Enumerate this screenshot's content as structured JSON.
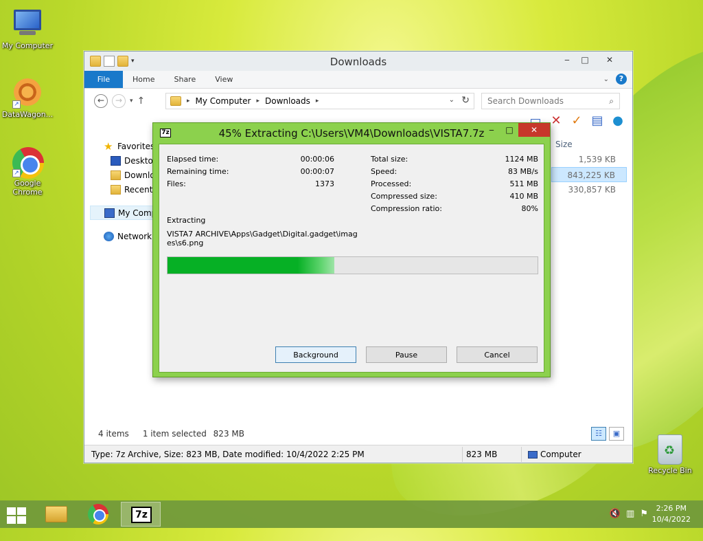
{
  "desktop": {
    "icons": [
      {
        "label": "My Computer"
      },
      {
        "label": "DataWagon..."
      },
      {
        "label": "Google Chrome"
      },
      {
        "label": "Recycle Bin"
      }
    ]
  },
  "explorer": {
    "title": "Downloads",
    "ribbon_tabs": [
      "File",
      "Home",
      "Share",
      "View"
    ],
    "breadcrumb": [
      "My Computer",
      "Downloads"
    ],
    "search_placeholder": "Search Downloads",
    "nav": {
      "favorites": "Favorites",
      "desktop": "Desktop",
      "downloads": "Downlo",
      "recent": "Recent p",
      "my_computer": "My Comp",
      "network": "Network"
    },
    "columns": {
      "size": "Size"
    },
    "file_sizes": [
      "1,539 KB",
      "843,225 KB",
      "330,857 KB"
    ],
    "status": {
      "items": "4 items",
      "selected": "1 item selected",
      "selected_size": "823 MB"
    },
    "details_bar": {
      "info": "Type: 7z Archive, Size: 823 MB, Date modified: 10/4/2022 2:25 PM",
      "size": "823 MB",
      "location": "Computer"
    }
  },
  "extract_dialog": {
    "logo": "7z",
    "title": "45% Extracting C:\\Users\\VM4\\Downloads\\VISTA7.7z",
    "progress": 0.45,
    "left_stats": [
      {
        "label": "Elapsed time:",
        "value": "00:00:06"
      },
      {
        "label": "Remaining time:",
        "value": "00:00:07"
      },
      {
        "label": "Files:",
        "value": "1373"
      }
    ],
    "right_stats": [
      {
        "label": "Total size:",
        "value": "1124 MB"
      },
      {
        "label": "Speed:",
        "value": "83 MB/s"
      },
      {
        "label": "Processed:",
        "value": "511 MB"
      },
      {
        "label": "Compressed size:",
        "value": "410 MB"
      },
      {
        "label": "Compression ratio:",
        "value": "80%"
      }
    ],
    "action_label": "Extracting",
    "current_file": "VISTA7 ARCHIVE\\Apps\\Gadget\\Digital.gadget\\images\\s6.png",
    "buttons": {
      "background": "Background",
      "pause": "Pause",
      "cancel": "Cancel"
    }
  },
  "taskbar": {
    "clock_time": "2:26 PM",
    "clock_date": "10/4/2022",
    "tb7z": "7z"
  },
  "colors": {
    "dialog_frame": "#8cd14d",
    "progress_fill": "#06b025",
    "ribbon_file": "#1979ca",
    "close_red": "#c7372b"
  }
}
